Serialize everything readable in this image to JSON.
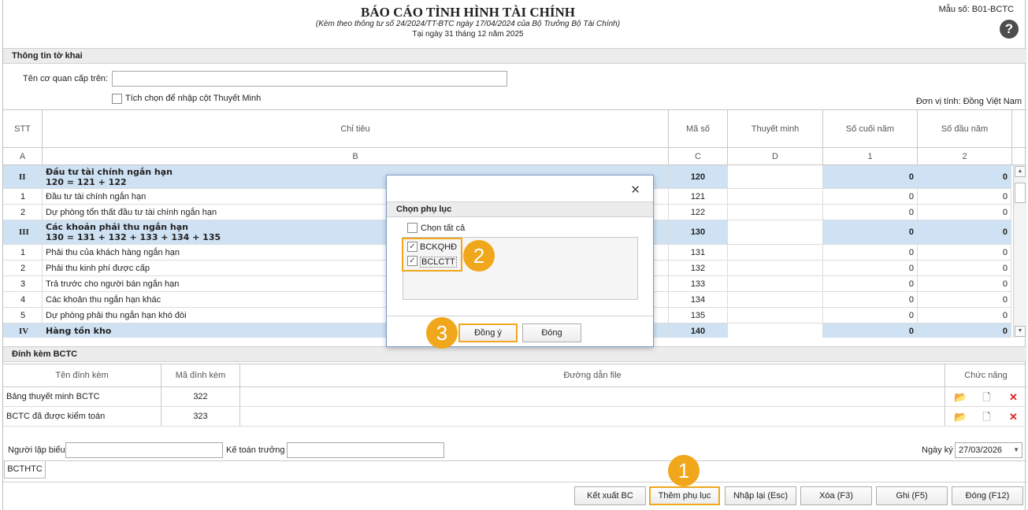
{
  "header": {
    "title": "BÁO CÁO TÌNH HÌNH TÀI CHÍNH",
    "subtitle": "(Kèm theo thông tư số 24/2024/TT-BTC ngày 17/04/2024 của Bộ Trưởng Bộ Tài Chính)",
    "date": "Tại ngày 31 tháng 12 năm 2025",
    "form_code": "Mẫu số: B01-BCTC",
    "help_glyph": "?"
  },
  "info": {
    "section_title": "Thông tin tờ khai",
    "parent_agency_label": "Tên cơ quan cấp trên:",
    "parent_agency_value": "",
    "explain_checkbox_label": "Tích chọn để nhập cột Thuyết Minh",
    "unit_label": "Đơn vị tính: Đồng Việt Nam"
  },
  "grid": {
    "columns": [
      "STT",
      "Chỉ tiêu",
      "Mã số",
      "Thuyết minh",
      "Số cuối năm",
      "Số đầu năm"
    ],
    "letters": [
      "A",
      "B",
      "C",
      "D",
      "1",
      "2"
    ],
    "rows": [
      {
        "stt": "II",
        "desc": "Đầu tư tài chính ngắn hạn\n120 = 121 + 122",
        "code": "120",
        "note": "",
        "end": "0",
        "start": "0",
        "group": true
      },
      {
        "stt": "1",
        "desc": "Đầu tư tài chính ngắn hạn",
        "code": "121",
        "note": "",
        "end": "0",
        "start": "0",
        "group": false
      },
      {
        "stt": "2",
        "desc": "Dự phòng tổn thất đầu tư tài chính ngắn hạn",
        "code": "122",
        "note": "",
        "end": "0",
        "start": "0",
        "group": false
      },
      {
        "stt": "III",
        "desc": "Các khoản phải thu ngắn hạn\n130 = 131 + 132 + 133 + 134 + 135",
        "code": "130",
        "note": "",
        "end": "0",
        "start": "0",
        "group": true
      },
      {
        "stt": "1",
        "desc": "Phải thu của khách hàng ngắn hạn",
        "code": "131",
        "note": "",
        "end": "0",
        "start": "0",
        "group": false
      },
      {
        "stt": "2",
        "desc": "Phải thu kinh phí được cấp",
        "code": "132",
        "note": "",
        "end": "0",
        "start": "0",
        "group": false
      },
      {
        "stt": "3",
        "desc": "Trả trước cho người bán ngắn hạn",
        "code": "133",
        "note": "",
        "end": "0",
        "start": "0",
        "group": false
      },
      {
        "stt": "4",
        "desc": "Các khoản thu ngắn hạn khác",
        "code": "134",
        "note": "",
        "end": "0",
        "start": "0",
        "group": false
      },
      {
        "stt": "5",
        "desc": "Dự phòng phải thu ngắn hạn khó đòi",
        "code": "135",
        "note": "",
        "end": "0",
        "start": "0",
        "group": false
      },
      {
        "stt": "IV",
        "desc": "Hàng tồn kho",
        "code": "140",
        "note": "",
        "end": "0",
        "start": "0",
        "group": true
      }
    ]
  },
  "attachments": {
    "section_title": "Đính kèm BCTC",
    "columns": [
      "Tên đính kèm",
      "Mã đính kèm",
      "Đường dẫn file",
      "Chức năng"
    ],
    "rows": [
      {
        "name": "Bảng thuyết minh BCTC",
        "code": "322",
        "path": ""
      },
      {
        "name": "BCTC đã được kiểm toán",
        "code": "323",
        "path": ""
      }
    ]
  },
  "signers": {
    "preparer_label": "Người lập biểu",
    "preparer_value": "",
    "chief_accountant_label": "Kế toán trưởng",
    "chief_accountant_value": "",
    "sign_date_label": "Ngày ký",
    "sign_date_value": "27/03/2026"
  },
  "tab": {
    "label": "BCTHTC"
  },
  "buttons": {
    "export": "Kết xuất BC",
    "add_appendix": "Thêm phụ lục",
    "reenter": "Nhập lại (Esc)",
    "delete": "Xóa (F3)",
    "save": "Ghi (F5)",
    "close": "Đóng (F12)"
  },
  "dialog": {
    "title": "Chọn phụ lục",
    "select_all_label": "Chọn tất cả",
    "select_all_checked": false,
    "options": [
      {
        "label": "BCKQHĐ",
        "checked": true
      },
      {
        "label": "BCLCTT",
        "checked": true
      }
    ],
    "ok_label": "Đồng ý",
    "close_label": "Đóng",
    "close_glyph": "✕"
  },
  "markers": [
    "1",
    "2",
    "3"
  ],
  "colors": {
    "accent_highlight": "#f0a71b",
    "group_row": "#cfe2f3",
    "section_bar": "#ececec"
  }
}
